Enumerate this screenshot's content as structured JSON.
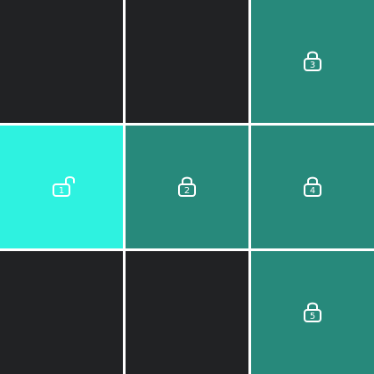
{
  "board": {
    "colors": {
      "background": "#ffffff",
      "empty_tile": "#212224",
      "locked_tile": "#27897b",
      "unlocked_tile": "#2ef2e0",
      "icon_stroke": "#ffffff"
    },
    "rows": [
      [
        {
          "state": "empty",
          "number": ""
        },
        {
          "state": "empty",
          "number": ""
        },
        {
          "state": "locked",
          "number": "3",
          "icon": "lock-closed-icon"
        }
      ],
      [
        {
          "state": "unlocked",
          "number": "1",
          "icon": "lock-open-icon"
        },
        {
          "state": "locked",
          "number": "2",
          "icon": "lock-closed-icon"
        },
        {
          "state": "locked",
          "number": "4",
          "icon": "lock-closed-icon"
        }
      ],
      [
        {
          "state": "empty",
          "number": ""
        },
        {
          "state": "empty",
          "number": ""
        },
        {
          "state": "locked",
          "number": "5",
          "icon": "lock-closed-icon"
        }
      ]
    ]
  }
}
